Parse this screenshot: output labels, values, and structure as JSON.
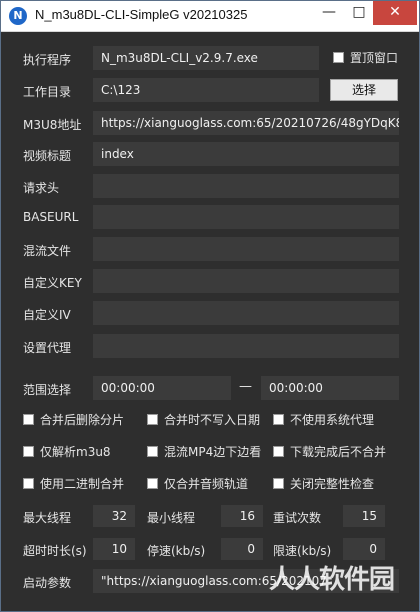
{
  "window": {
    "title": "N_m3u8DL-CLI-SimpleG v20210325",
    "app_icon_letter": "N"
  },
  "controls": {
    "minimize": "—",
    "maximize": "□",
    "close": "✕"
  },
  "labels": {
    "exe": "执行程序",
    "workdir": "工作目录",
    "m3u8": "M3U8地址",
    "title": "视频标题",
    "headers": "请求头",
    "baseurl": "BASEURL",
    "mux": "混流文件",
    "key": "自定义KEY",
    "iv": "自定义IV",
    "proxy": "设置代理",
    "range": "范围选择",
    "max_threads": "最大线程",
    "min_threads": "最小线程",
    "retry": "重试次数",
    "timeout": "超时时长(s)",
    "stop_speed": "停速(kb/s)",
    "limit_speed": "限速(kb/s)",
    "launch": "启动参数"
  },
  "fields": {
    "exe": "N_m3u8DL-CLI_v2.9.7.exe",
    "workdir": "C:\\123",
    "m3u8": "https://xianguoglass.com:65/20210726/48gYDqK8/",
    "title": "index",
    "headers": "",
    "baseurl": "",
    "mux": "",
    "key": "",
    "iv": "",
    "proxy": "",
    "range_start": "00:00:00",
    "range_end": "00:00:00",
    "launch": "\"https://xianguoglass.com:65/202107"
  },
  "range_separator": "—",
  "buttons": {
    "choose": "选择"
  },
  "checkboxes": {
    "topmost": "置顶窗口",
    "delete_after_merge": "合并后删除分片",
    "no_date_on_merge": "合并时不写入日期",
    "no_system_proxy": "不使用系统代理",
    "parse_only": "仅解析m3u8",
    "mux_mp4_while_download": "混流MP4边下边看",
    "no_merge_after_download": "下载完成后不合并",
    "binary_merge": "使用二进制合并",
    "audio_only": "仅合并音频轨道",
    "disable_integrity": "关闭完整性检查"
  },
  "numbers": {
    "max_threads": "32",
    "min_threads": "16",
    "retry": "15",
    "timeout": "10",
    "stop_speed": "0",
    "limit_speed": "0"
  },
  "watermark": "人人软件园"
}
